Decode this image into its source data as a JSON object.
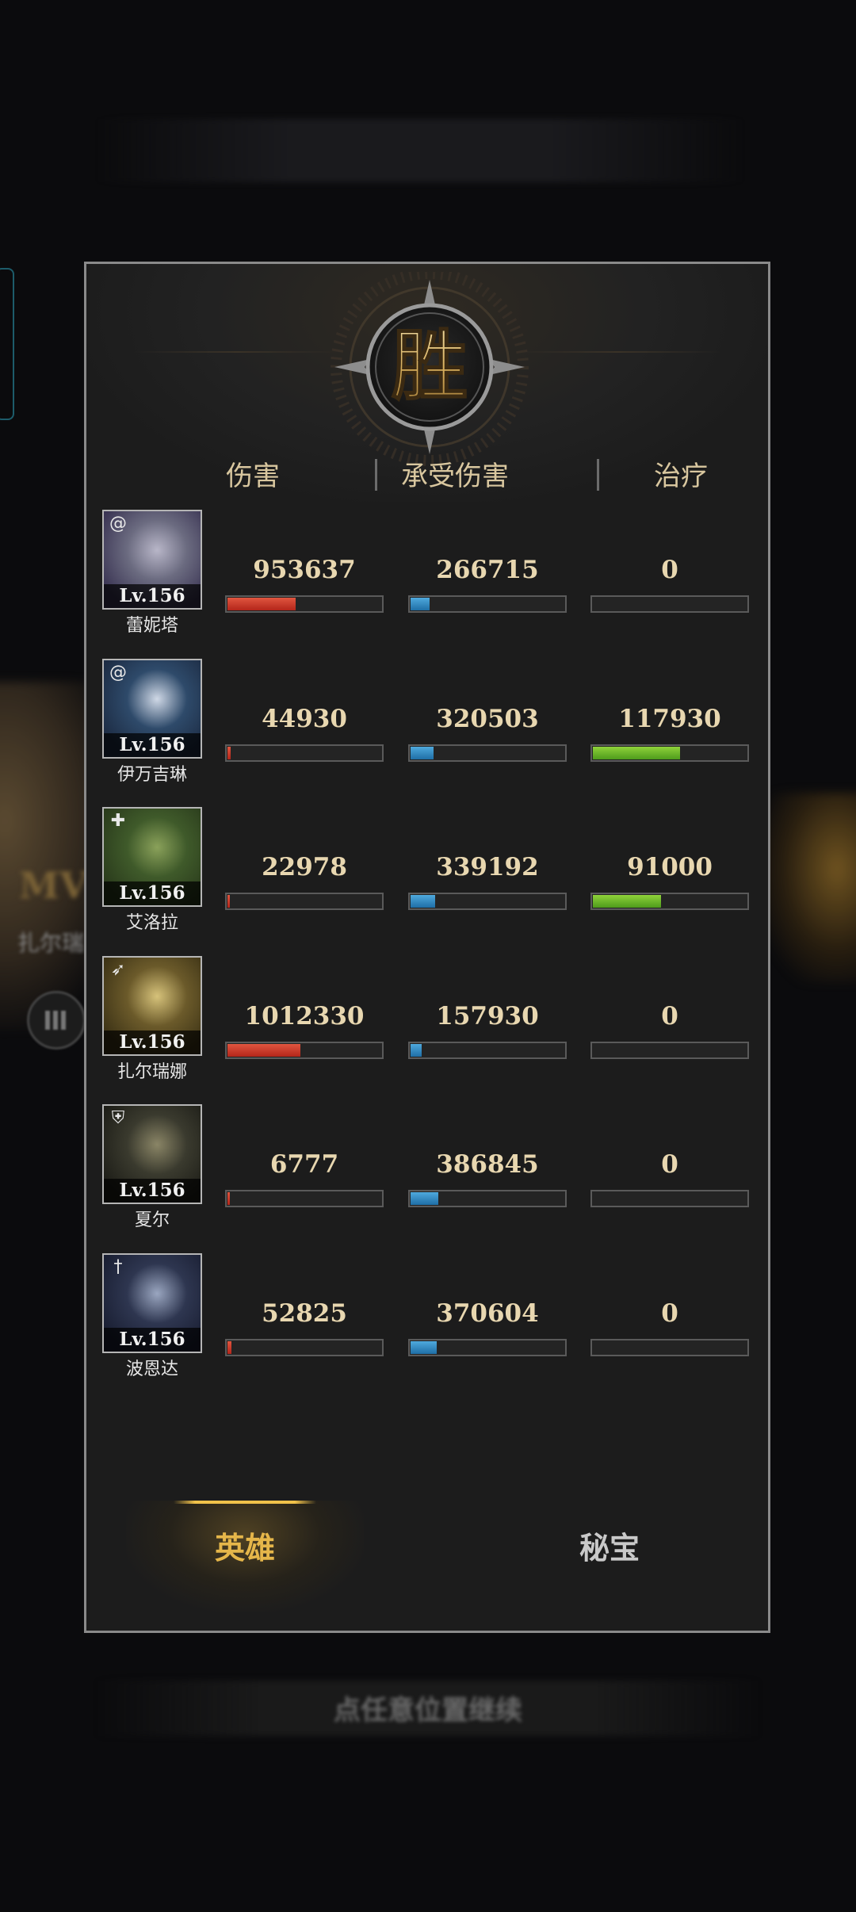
{
  "emblem": {
    "char": "胜"
  },
  "columns": {
    "damage": "伤害",
    "taken": "承受伤害",
    "healing": "治疗"
  },
  "colors": {
    "damage": "#c8372a",
    "taken": "#2f8bc6",
    "healing": "#6cbf2a",
    "accent": "#e5b64a"
  },
  "heroes": [
    {
      "name": "蕾妮塔",
      "level": "Lv.156",
      "icon": "spiral-icon",
      "damage": "953637",
      "taken": "266715",
      "healing": "0",
      "damage_ratio": 0.44,
      "taken_ratio": 0.12,
      "healing_ratio": 0
    },
    {
      "name": "伊万吉琳",
      "level": "Lv.156",
      "icon": "spiral-icon",
      "damage": "44930",
      "taken": "320503",
      "healing": "117930",
      "damage_ratio": 0.02,
      "taken_ratio": 0.15,
      "healing_ratio": 0.56
    },
    {
      "name": "艾洛拉",
      "level": "Lv.156",
      "icon": "support-icon",
      "damage": "22978",
      "taken": "339192",
      "healing": "91000",
      "damage_ratio": 0.015,
      "taken_ratio": 0.16,
      "healing_ratio": 0.44
    },
    {
      "name": "扎尔瑞娜",
      "level": "Lv.156",
      "icon": "bow-icon",
      "damage": "1012330",
      "taken": "157930",
      "healing": "0",
      "damage_ratio": 0.47,
      "taken_ratio": 0.07,
      "healing_ratio": 0
    },
    {
      "name": "夏尔",
      "level": "Lv.156",
      "icon": "shield-icon",
      "damage": "6777",
      "taken": "386845",
      "healing": "0",
      "damage_ratio": 0.008,
      "taken_ratio": 0.18,
      "healing_ratio": 0
    },
    {
      "name": "波恩达",
      "level": "Lv.156",
      "icon": "dagger-icon",
      "damage": "52825",
      "taken": "370604",
      "healing": "0",
      "damage_ratio": 0.025,
      "taken_ratio": 0.17,
      "healing_ratio": 0
    }
  ],
  "tabs": {
    "heroes": "英雄",
    "treasure": "秘宝"
  },
  "background": {
    "continue_hint": "点任意位置继续",
    "mvp_text": "MV",
    "bg_name": "扎尔瑞"
  }
}
